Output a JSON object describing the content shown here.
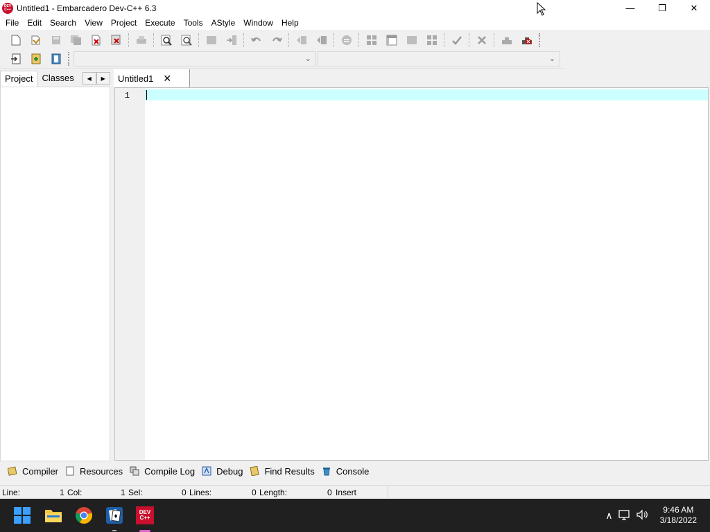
{
  "window": {
    "title": "Untitled1 - Embarcadero Dev-C++ 6.3",
    "logo_text": "DEV C++",
    "minimize": "—",
    "restore": "❐",
    "close": "✕"
  },
  "menu": [
    "File",
    "Edit",
    "Search",
    "View",
    "Project",
    "Execute",
    "Tools",
    "AStyle",
    "Window",
    "Help"
  ],
  "left_panel": {
    "tabs": [
      "Project",
      "Classes"
    ],
    "arrow_left": "◀",
    "arrow_right": "▶"
  },
  "editor": {
    "tab_label": "Untitled1",
    "tab_close": "✕",
    "line_number": "1"
  },
  "bottom_tabs": [
    "Compiler",
    "Resources",
    "Compile Log",
    "Debug",
    "Find Results",
    "Console"
  ],
  "status": {
    "line_label": "Line:",
    "line_value": "1",
    "col_label": "Col:",
    "col_value": "1",
    "sel_label": "Sel:",
    "sel_value": "0",
    "lines_label": "Lines:",
    "lines_value": "0",
    "length_label": "Length:",
    "length_value": "0",
    "mode": "Insert"
  },
  "taskbar": {
    "time": "9:46 AM",
    "date": "3/18/2022",
    "devcpp_label": "DEV C++",
    "tray_chevron": "∧"
  },
  "colors": {
    "active_line": "#ccffff",
    "taskbar": "#202020",
    "devcpp_red": "#c8102e"
  }
}
